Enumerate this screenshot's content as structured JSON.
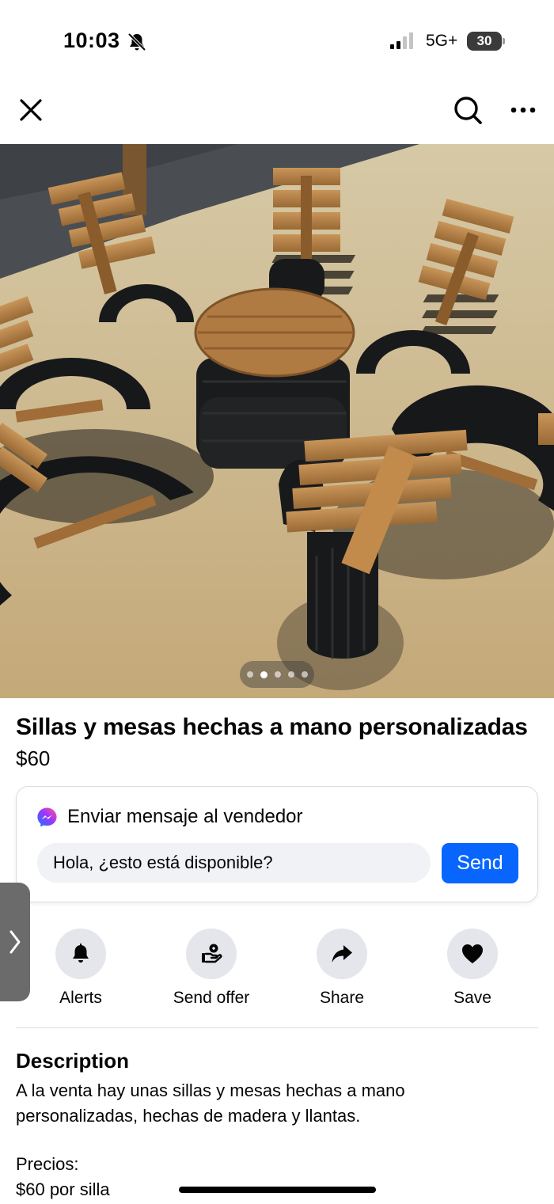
{
  "status_bar": {
    "time": "10:03",
    "network": "5G+",
    "battery": "30",
    "icons": [
      "bell-off-icon",
      "signal-icon",
      "battery-icon"
    ]
  },
  "nav": {
    "icons": [
      "close-icon",
      "search-icon",
      "more-icon"
    ]
  },
  "photo": {
    "total_images": 5,
    "active_index": 1
  },
  "listing": {
    "title": "Sillas y mesas hechas a mano personalizadas",
    "price": "$60"
  },
  "message": {
    "heading": "Enviar mensaje al vendedor",
    "input_value": "Hola, ¿esto está disponible?",
    "send_label": "Send"
  },
  "actions": [
    {
      "label": "Alerts",
      "icon": "bell-icon"
    },
    {
      "label": "Send offer",
      "icon": "offer-icon"
    },
    {
      "label": "Share",
      "icon": "share-icon"
    },
    {
      "label": "Save",
      "icon": "heart-icon"
    }
  ],
  "description": {
    "heading": "Description",
    "body": "A la venta hay unas sillas y mesas hechas a mano personalizadas, hechas de madera y llantas.",
    "prices_label": "Precios:",
    "price_line": "$60 por silla"
  },
  "colors": {
    "accent": "#0866ff",
    "action_circle": "#e4e6eb",
    "input_bg": "#f0f2f5"
  }
}
